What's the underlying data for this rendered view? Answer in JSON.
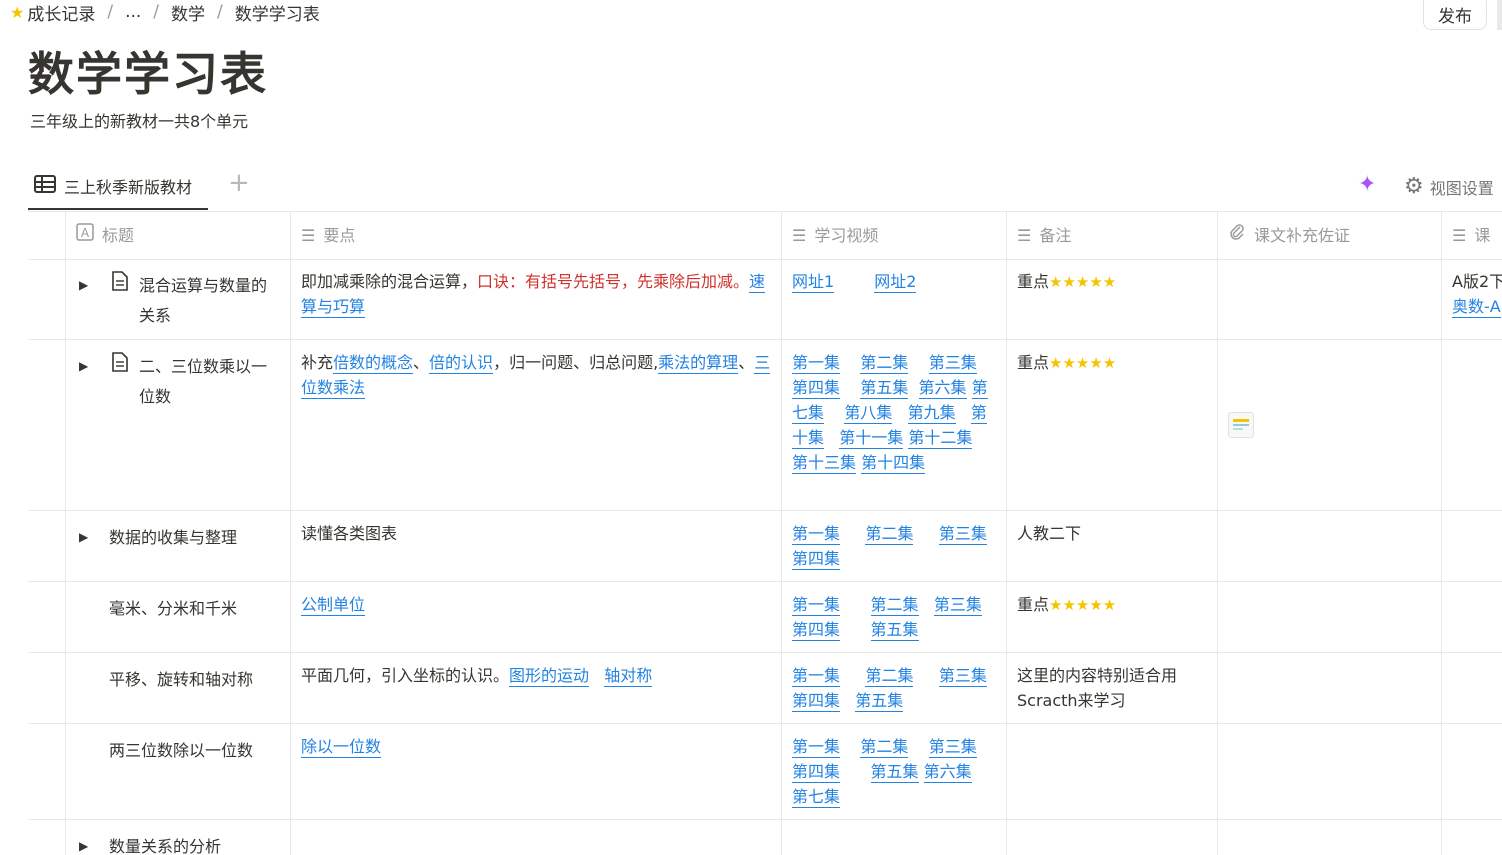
{
  "breadcrumb": {
    "items": [
      "成长记录",
      "...",
      "数学",
      "数学学习表"
    ],
    "separator": "/"
  },
  "publish_label": "发布",
  "page": {
    "title": "数学学习表",
    "description": "三年级上的新教材一共8个单元"
  },
  "tabs": {
    "active_label": "三上秋季新版教材",
    "add_label": "+",
    "view_settings_label": "视图设置"
  },
  "columns": {
    "title": "标题",
    "points": "要点",
    "video": "学习视频",
    "note": "备注",
    "proof": "课文补充佐证",
    "extra": "课"
  },
  "rows": [
    {
      "title": "混合运算与数量的关系",
      "points_text": "即加减乘除的混合运算，",
      "points_red": "口诀：有括号先括号，先乘除后加减。",
      "points_link": "速算与巧算",
      "video_links": [
        "网址1",
        "网址2"
      ],
      "note": "重点",
      "stars": 5,
      "extra_text": "A版2下",
      "extra_link": "奥数-A"
    },
    {
      "title": "二、三位数乘以一位数",
      "points_prefix": "补充",
      "points_links": [
        "倍数的概念",
        "倍的认识",
        "乘法的算理",
        "三位数乘法"
      ],
      "points_mid": "归一问题、归总问题,",
      "video_links": [
        "第一集",
        "第二集",
        "第三集",
        "第四集",
        "第五集",
        "第六集",
        "第七集",
        "第八集",
        "第九集",
        "第十集",
        "第十一集",
        "第十二集",
        "第十三集",
        "第十四集"
      ],
      "note": "重点",
      "stars": 5
    },
    {
      "title": "数据的收集与整理",
      "points_text": "读懂各类图表",
      "video_links": [
        "第一集",
        "第二集",
        "第三集",
        "第四集"
      ],
      "note": "人教二下"
    },
    {
      "title": "毫米、分米和千米",
      "points_link": "公制单位",
      "video_links": [
        "第一集",
        "第二集",
        "第三集",
        "第四集",
        "第五集"
      ],
      "note": "重点",
      "stars": 5
    },
    {
      "title": "平移、旋转和轴对称",
      "points_text": "平面几何，引入坐标的认识。",
      "points_links": [
        "图形的运动",
        "轴对称"
      ],
      "video_links": [
        "第一集",
        "第二集",
        "第三集",
        "第四集",
        "第五集"
      ],
      "note": "这里的内容特别适合用Scracth来学习"
    },
    {
      "title": "两三位数除以一位数",
      "points_link": "除以一位数",
      "video_links": [
        "第一集",
        "第二集",
        "第三集",
        "第四集",
        "第五集",
        "第六集",
        "第七集"
      ]
    },
    {
      "title": "数量关系的分析"
    }
  ]
}
